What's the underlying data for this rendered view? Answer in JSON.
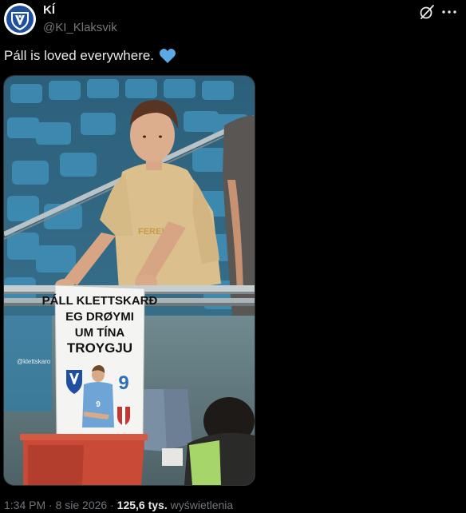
{
  "author": {
    "display_name": "KÍ",
    "handle": "@KI_Klaksvik"
  },
  "tweet": {
    "text": "Páll is loved everywhere.",
    "emoji": "blue-heart"
  },
  "photo": {
    "watermark": "@klettskaro",
    "sign_lines": [
      "PÁLL KLETTSKARÐ",
      "EG DRØYMI",
      "UM TÍNA",
      "TROYGJU"
    ],
    "sign_number": "9",
    "jersey_number": "9"
  },
  "meta": {
    "time": "1:34 PM",
    "date": "8 sie 2026",
    "separator": "·",
    "views_count": "125,6 tys.",
    "views_label": "wyświetlenia"
  },
  "colors": {
    "background": "#000000",
    "text_primary": "#e7e9ea",
    "text_secondary": "#71767b",
    "heart": "#5aa9e6"
  }
}
